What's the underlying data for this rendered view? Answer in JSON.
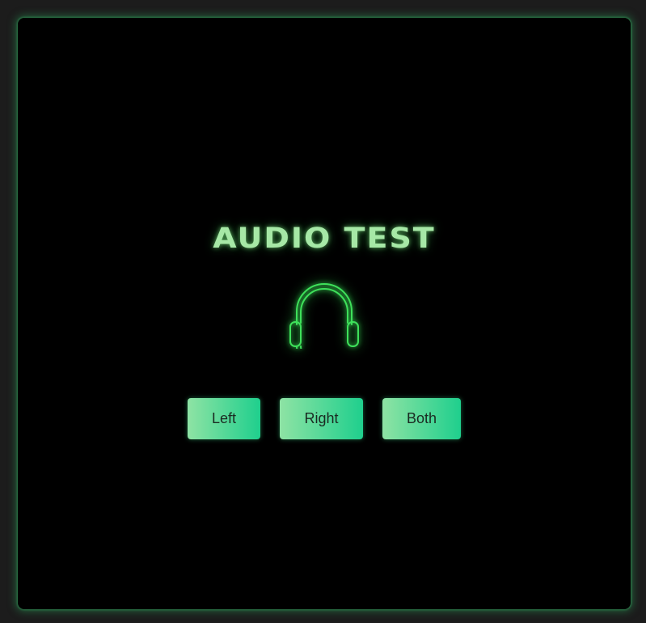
{
  "panel": {
    "title": "AUDIO TEST",
    "icon": "headset-icon",
    "accent_color": "#3ee05a"
  },
  "buttons": {
    "left": "Left",
    "right": "Right",
    "both": "Both"
  }
}
